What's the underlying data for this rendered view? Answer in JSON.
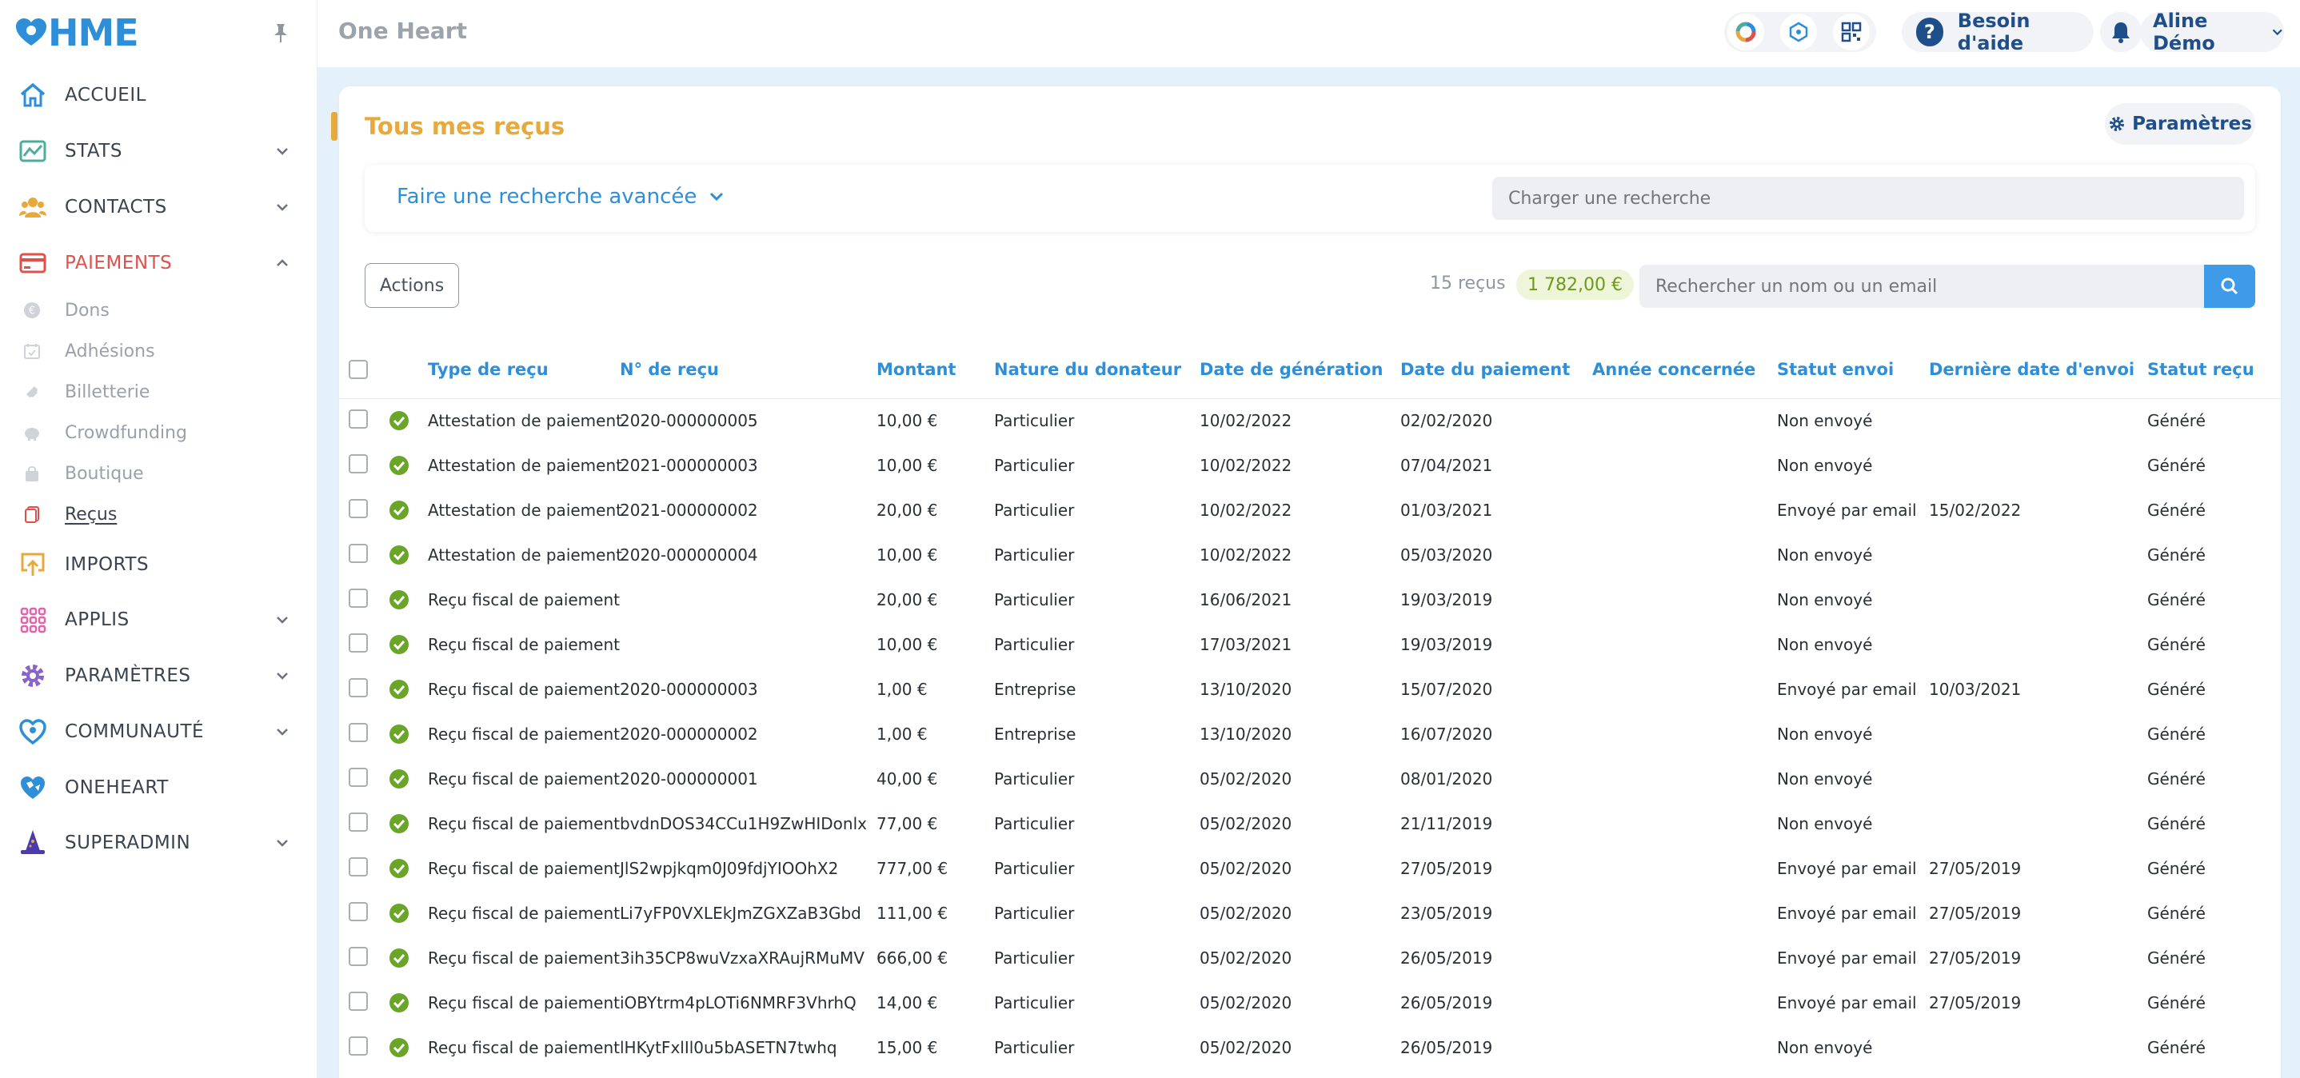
{
  "brand": {
    "logo_text": "HME"
  },
  "sidebar": {
    "items": [
      {
        "label": "ACCUEIL",
        "icon": "home-icon",
        "color": "#2e8fd8",
        "has_chevron": false
      },
      {
        "label": "STATS",
        "icon": "chart-icon",
        "color": "#4cae9a",
        "has_chevron": true
      },
      {
        "label": "CONTACTS",
        "icon": "users-icon",
        "color": "#e7a93b",
        "has_chevron": true
      },
      {
        "label": "PAIEMENTS",
        "icon": "credit-card-icon",
        "color": "#e1504a",
        "has_chevron": true,
        "expanded": true,
        "active": true
      },
      {
        "label": "IMPORTS",
        "icon": "upload-icon",
        "color": "#e7a93b",
        "has_chevron": false
      },
      {
        "label": "APPLIS",
        "icon": "grid-icon",
        "color": "#e264a8",
        "has_chevron": true
      },
      {
        "label": "PARAMÈTRES",
        "icon": "gear-icon",
        "color": "#8a63c9",
        "has_chevron": true
      },
      {
        "label": "COMMUNAUTÉ",
        "icon": "heart-icon",
        "color": "#2e8fd8",
        "has_chevron": true
      },
      {
        "label": "ONEHEART",
        "icon": "globe-heart-icon",
        "color": "#2e8fd8",
        "has_chevron": false
      },
      {
        "label": "SUPERADMIN",
        "icon": "wizard-hat-icon",
        "color": "#4b3bb0",
        "has_chevron": true
      }
    ],
    "sub_items": [
      {
        "label": "Dons",
        "icon": "euro-coin-icon"
      },
      {
        "label": "Adhésions",
        "icon": "calendar-check-icon"
      },
      {
        "label": "Billetterie",
        "icon": "ticket-icon"
      },
      {
        "label": "Crowdfunding",
        "icon": "piggy-bank-icon"
      },
      {
        "label": "Boutique",
        "icon": "shopping-bag-icon"
      },
      {
        "label": "Reçus",
        "icon": "receipt-icon",
        "current": true
      }
    ]
  },
  "topbar": {
    "app_title": "One Heart",
    "help_label": "Besoin d'aide",
    "user_label": "Aline Démo"
  },
  "page": {
    "title": "Tous mes reçus",
    "params_label": "Paramètres",
    "advanced_search_label": "Faire une recherche avancée",
    "load_search_placeholder": "Charger une recherche",
    "actions_label": "Actions",
    "receipt_count": "15 reçus",
    "total_amount": "1 782,00 €",
    "name_search_placeholder": "Rechercher un nom ou un email"
  },
  "table": {
    "columns": [
      "Type de reçu",
      "N° de reçu",
      "Montant",
      "Nature du donateur",
      "Date de génération",
      "Date du paiement",
      "Année concernée",
      "Statut envoi",
      "Dernière date d'envoi",
      "Statut reçu"
    ],
    "rows": [
      [
        "Attestation de paiement",
        "2020-000000005",
        "10,00 €",
        "Particulier",
        "10/02/2022",
        "02/02/2020",
        "",
        "Non envoyé",
        "",
        "Généré"
      ],
      [
        "Attestation de paiement",
        "2021-000000003",
        "10,00 €",
        "Particulier",
        "10/02/2022",
        "07/04/2021",
        "",
        "Non envoyé",
        "",
        "Généré"
      ],
      [
        "Attestation de paiement",
        "2021-000000002",
        "20,00 €",
        "Particulier",
        "10/02/2022",
        "01/03/2021",
        "",
        "Envoyé par email",
        "15/02/2022",
        "Généré"
      ],
      [
        "Attestation de paiement",
        "2020-000000004",
        "10,00 €",
        "Particulier",
        "10/02/2022",
        "05/03/2020",
        "",
        "Non envoyé",
        "",
        "Généré"
      ],
      [
        "Reçu fiscal de paiement",
        "",
        "20,00 €",
        "Particulier",
        "16/06/2021",
        "19/03/2019",
        "",
        "Non envoyé",
        "",
        "Généré"
      ],
      [
        "Reçu fiscal de paiement",
        "",
        "10,00 €",
        "Particulier",
        "17/03/2021",
        "19/03/2019",
        "",
        "Non envoyé",
        "",
        "Généré"
      ],
      [
        "Reçu fiscal de paiement",
        "2020-000000003",
        "1,00 €",
        "Entreprise",
        "13/10/2020",
        "15/07/2020",
        "",
        "Envoyé par email",
        "10/03/2021",
        "Généré"
      ],
      [
        "Reçu fiscal de paiement",
        "2020-000000002",
        "1,00 €",
        "Entreprise",
        "13/10/2020",
        "16/07/2020",
        "",
        "Non envoyé",
        "",
        "Généré"
      ],
      [
        "Reçu fiscal de paiement",
        "2020-000000001",
        "40,00 €",
        "Particulier",
        "05/02/2020",
        "08/01/2020",
        "",
        "Non envoyé",
        "",
        "Généré"
      ],
      [
        "Reçu fiscal de paiement",
        "bvdnDOS34CCu1H9ZwHIDonlx",
        "77,00 €",
        "Particulier",
        "05/02/2020",
        "21/11/2019",
        "",
        "Non envoyé",
        "",
        "Généré"
      ],
      [
        "Reçu fiscal de paiement",
        "JlS2wpjkqm0J09fdjYIOOhX2",
        "777,00 €",
        "Particulier",
        "05/02/2020",
        "27/05/2019",
        "",
        "Envoyé par email",
        "27/05/2019",
        "Généré"
      ],
      [
        "Reçu fiscal de paiement",
        "Li7yFP0VXLEkJmZGXZaB3Gbd",
        "111,00 €",
        "Particulier",
        "05/02/2020",
        "23/05/2019",
        "",
        "Envoyé par email",
        "27/05/2019",
        "Généré"
      ],
      [
        "Reçu fiscal de paiement",
        "3ih35CP8wuVzxaXRAujRMuMV",
        "666,00 €",
        "Particulier",
        "05/02/2020",
        "26/05/2019",
        "",
        "Envoyé par email",
        "27/05/2019",
        "Généré"
      ],
      [
        "Reçu fiscal de paiement",
        "iOBYtrm4pLOTi6NMRF3VhrhQ",
        "14,00 €",
        "Particulier",
        "05/02/2020",
        "26/05/2019",
        "",
        "Envoyé par email",
        "27/05/2019",
        "Généré"
      ],
      [
        "Reçu fiscal de paiement",
        "lHKytFxlIl0u5bASETN7twhq",
        "15,00 €",
        "Particulier",
        "05/02/2020",
        "26/05/2019",
        "",
        "Non envoyé",
        "",
        "Généré"
      ]
    ]
  },
  "colors": {
    "accent": "#2e8fd8",
    "title": "#e7a93b",
    "danger": "#e1504a",
    "success": "#6aa52a"
  }
}
